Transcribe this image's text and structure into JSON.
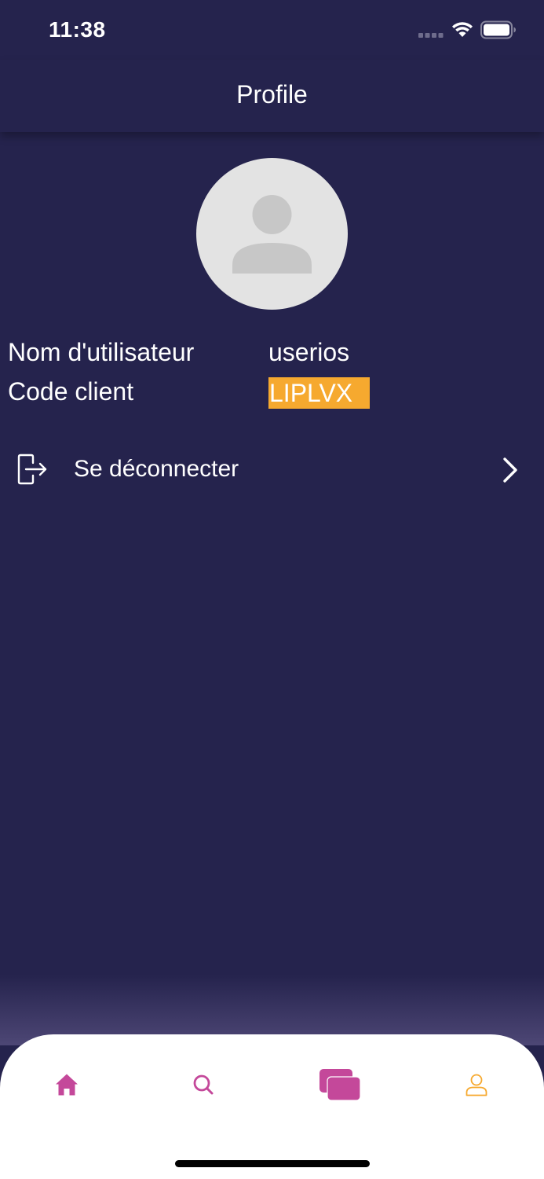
{
  "status_bar": {
    "time": "11:38"
  },
  "header": {
    "title": "Profile"
  },
  "profile": {
    "username_label": "Nom d'utilisateur",
    "username_value": "userios",
    "client_code_label": "Code client",
    "client_code_value": "LIPLVX"
  },
  "actions": {
    "logout_label": "Se déconnecter"
  },
  "tab_bar": {
    "tabs": [
      {
        "icon": "home-icon",
        "selected": false
      },
      {
        "icon": "search-icon",
        "selected": false
      },
      {
        "icon": "chat-icon",
        "selected": false
      },
      {
        "icon": "user-icon",
        "selected": true
      }
    ]
  },
  "colors": {
    "background": "#25234d",
    "accent_magenta": "#c4489a",
    "accent_orange": "#f6a92f",
    "tab_bar_background": "#ffffff",
    "avatar_background": "#e3e3e3"
  }
}
